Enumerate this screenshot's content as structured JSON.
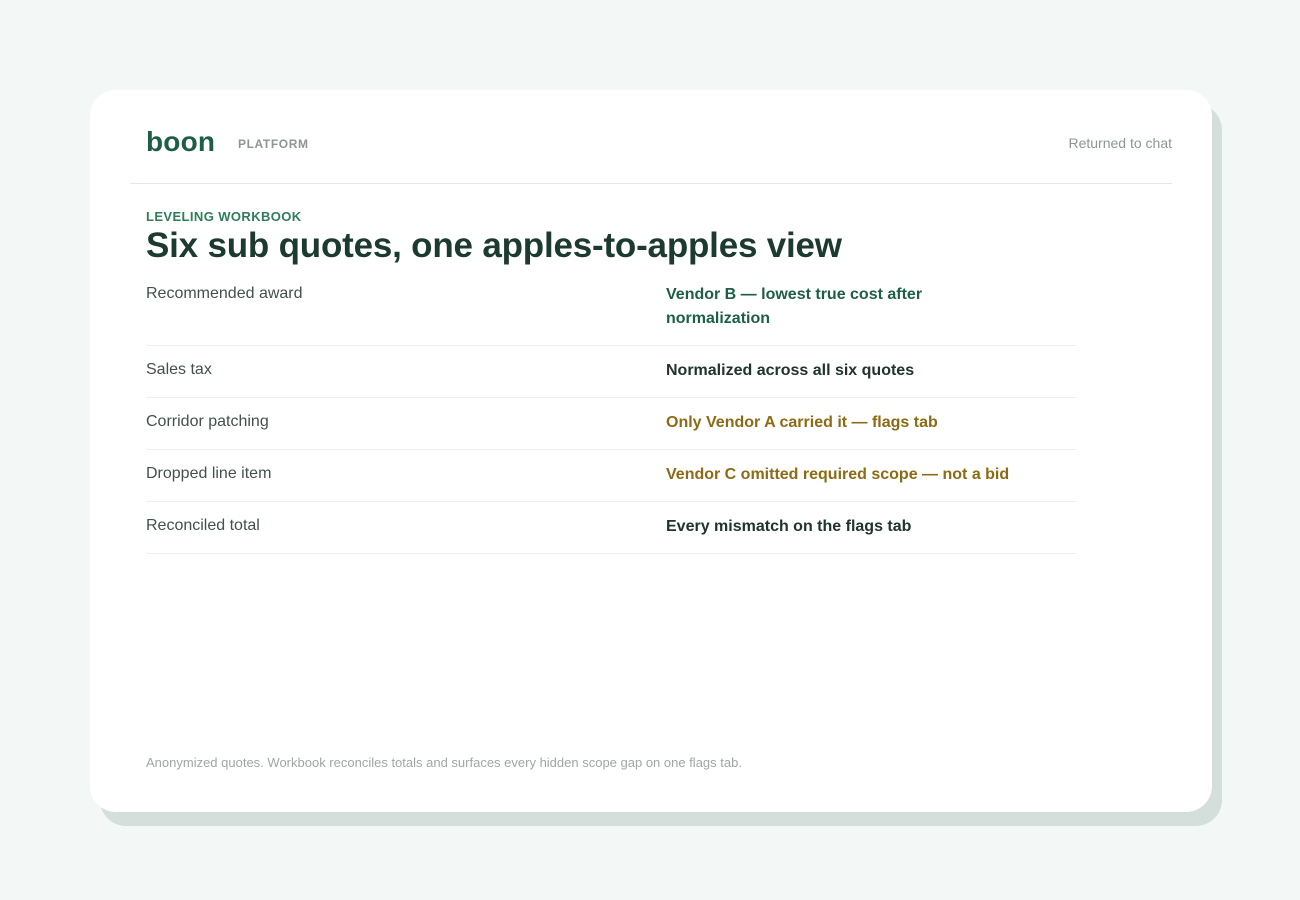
{
  "header": {
    "logo": "boon",
    "section": "PLATFORM",
    "status_link": "Returned to chat"
  },
  "main": {
    "eyebrow": "LEVELING WORKBOOK",
    "title": "Six sub quotes, one apples-to-apples view",
    "rows": [
      {
        "label": "Recommended award",
        "value": "Vendor B — lowest true cost after normalization",
        "tone": "accent"
      },
      {
        "label": "Sales tax",
        "value": "Normalized across all six quotes",
        "tone": "default"
      },
      {
        "label": "Corridor patching",
        "value": "Only Vendor A carried it — flags tab",
        "tone": "warning"
      },
      {
        "label": "Dropped line item",
        "value": "Vendor C omitted required scope — not a bid",
        "tone": "warning"
      },
      {
        "label": "Reconciled total",
        "value": "Every mismatch on the flags tab",
        "tone": "default"
      }
    ],
    "footnote": "Anonymized quotes. Workbook reconciles totals and surfaces every hidden scope gap on one flags tab."
  },
  "colors": {
    "background": "#f3f8f6",
    "brand": "#1e5e46",
    "eyebrow": "#2e7d5b",
    "warning": "#8d6b14",
    "title": "#1d3a30"
  }
}
